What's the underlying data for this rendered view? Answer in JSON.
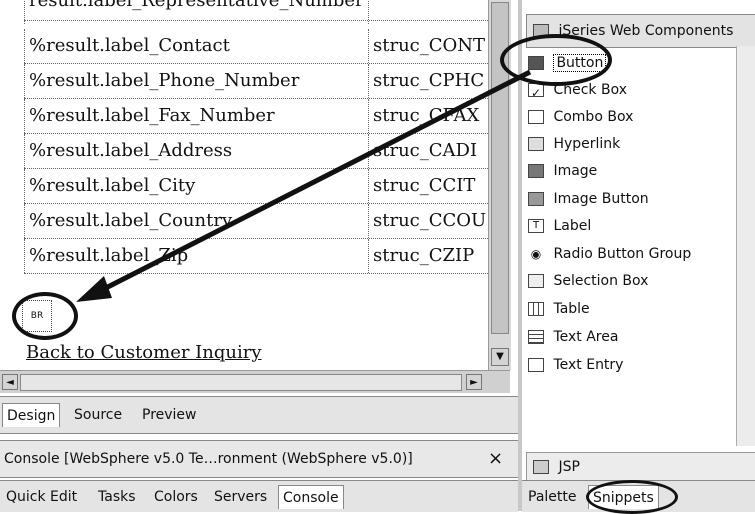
{
  "editor": {
    "form_rows": [
      {
        "label": "result.label_Representative_Number",
        "value": ""
      },
      {
        "label": "%result.label_Contact",
        "value": "struc_CONT"
      },
      {
        "label": "%result.label_Phone_Number",
        "value": "struc_CPHC"
      },
      {
        "label": "%result.label_Fax_Number",
        "value": "struc_CFAX"
      },
      {
        "label": "%result.label_Address",
        "value": "struc_CADI"
      },
      {
        "label": "%result.label_City",
        "value": "struc_CCIT"
      },
      {
        "label": "%result.label_Country",
        "value": "struc_CCOU"
      },
      {
        "label": "%result.label_Zip",
        "value": "struc_CZIP"
      }
    ],
    "br_tag": "BR",
    "back_link": "Back to Customer Inquiry",
    "tabs": [
      "Design",
      "Source",
      "Preview"
    ],
    "active_tab": "Design"
  },
  "console": {
    "title": "Console [WebSphere v5.0 Te…ronment (WebSphere v5.0)]",
    "close": "×"
  },
  "bottom_tabs": [
    "Quick Edit",
    "Tasks",
    "Colors",
    "Servers",
    "Console"
  ],
  "palette": {
    "drawer": "iSeries Web Components",
    "items": [
      {
        "label": "Button",
        "icon": "button-icon"
      },
      {
        "label": "Check Box",
        "icon": "check-box-icon"
      },
      {
        "label": "Combo Box",
        "icon": "combo-box-icon"
      },
      {
        "label": "Hyperlink",
        "icon": "hyperlink-icon"
      },
      {
        "label": "Image",
        "icon": "image-icon"
      },
      {
        "label": "Image Button",
        "icon": "image-button-icon"
      },
      {
        "label": "Label",
        "icon": "label-icon"
      },
      {
        "label": "Radio Button Group",
        "icon": "radio-button-group-icon"
      },
      {
        "label": "Selection Box",
        "icon": "selection-box-icon"
      },
      {
        "label": "Table",
        "icon": "table-icon"
      },
      {
        "label": "Text Area",
        "icon": "text-area-icon"
      },
      {
        "label": "Text Entry",
        "icon": "text-entry-icon"
      }
    ],
    "jsp": "JSP",
    "tabs": [
      "Palette",
      "Snippets"
    ]
  },
  "scroll": {
    "up": "▲",
    "down": "▼",
    "left": "◄",
    "right": "►"
  }
}
